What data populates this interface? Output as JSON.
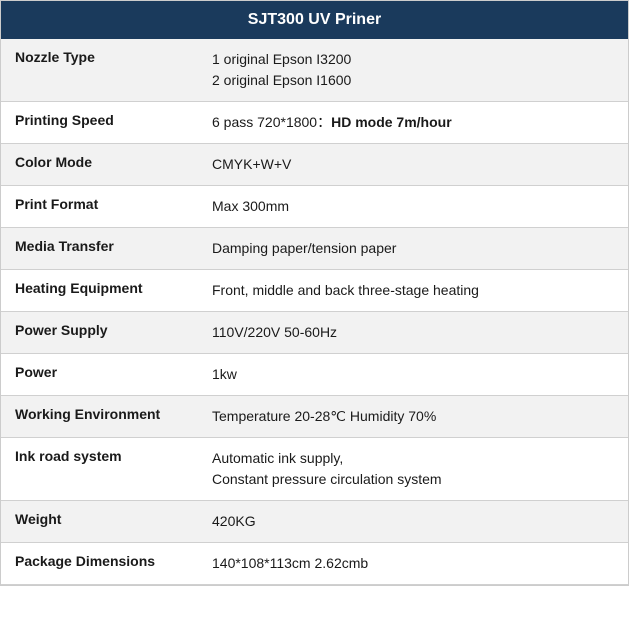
{
  "header": {
    "title": "SJT300 UV Priner"
  },
  "rows": [
    {
      "label": "Nozzle Type",
      "value": "1 original Epson I3200\n2 original Epson I1600",
      "value_html": "1 original Epson I3200<br>2 original Epson I1600"
    },
    {
      "label": "Printing Speed",
      "value": "6 pass 720*1800：HD mode 7m/hour",
      "value_prefix": "6 pass 720*1800：",
      "value_bold": "HD mode 7m/hour"
    },
    {
      "label": "Color Mode",
      "value": "CMYK+W+V"
    },
    {
      "label": "Print Format",
      "value": "Max 300mm"
    },
    {
      "label": "Media Transfer",
      "value": "Damping paper/tension paper"
    },
    {
      "label": "Heating Equipment",
      "value": "Front, middle and back three-stage heating"
    },
    {
      "label": "Power Supply",
      "value": "110V/220V 50-60Hz"
    },
    {
      "label": "Power",
      "value": "1kw"
    },
    {
      "label": "Working Environment",
      "value": "Temperature 20-28℃ Humidity 70%"
    },
    {
      "label": "Ink road system",
      "value": "Automatic ink supply,\nConstant pressure circulation system",
      "value_html": "Automatic ink supply,<br>Constant pressure circulation system"
    },
    {
      "label": "Weight",
      "value": "420KG"
    },
    {
      "label": "Package Dimensions",
      "value": "140*108*113cm 2.62cmb"
    }
  ]
}
